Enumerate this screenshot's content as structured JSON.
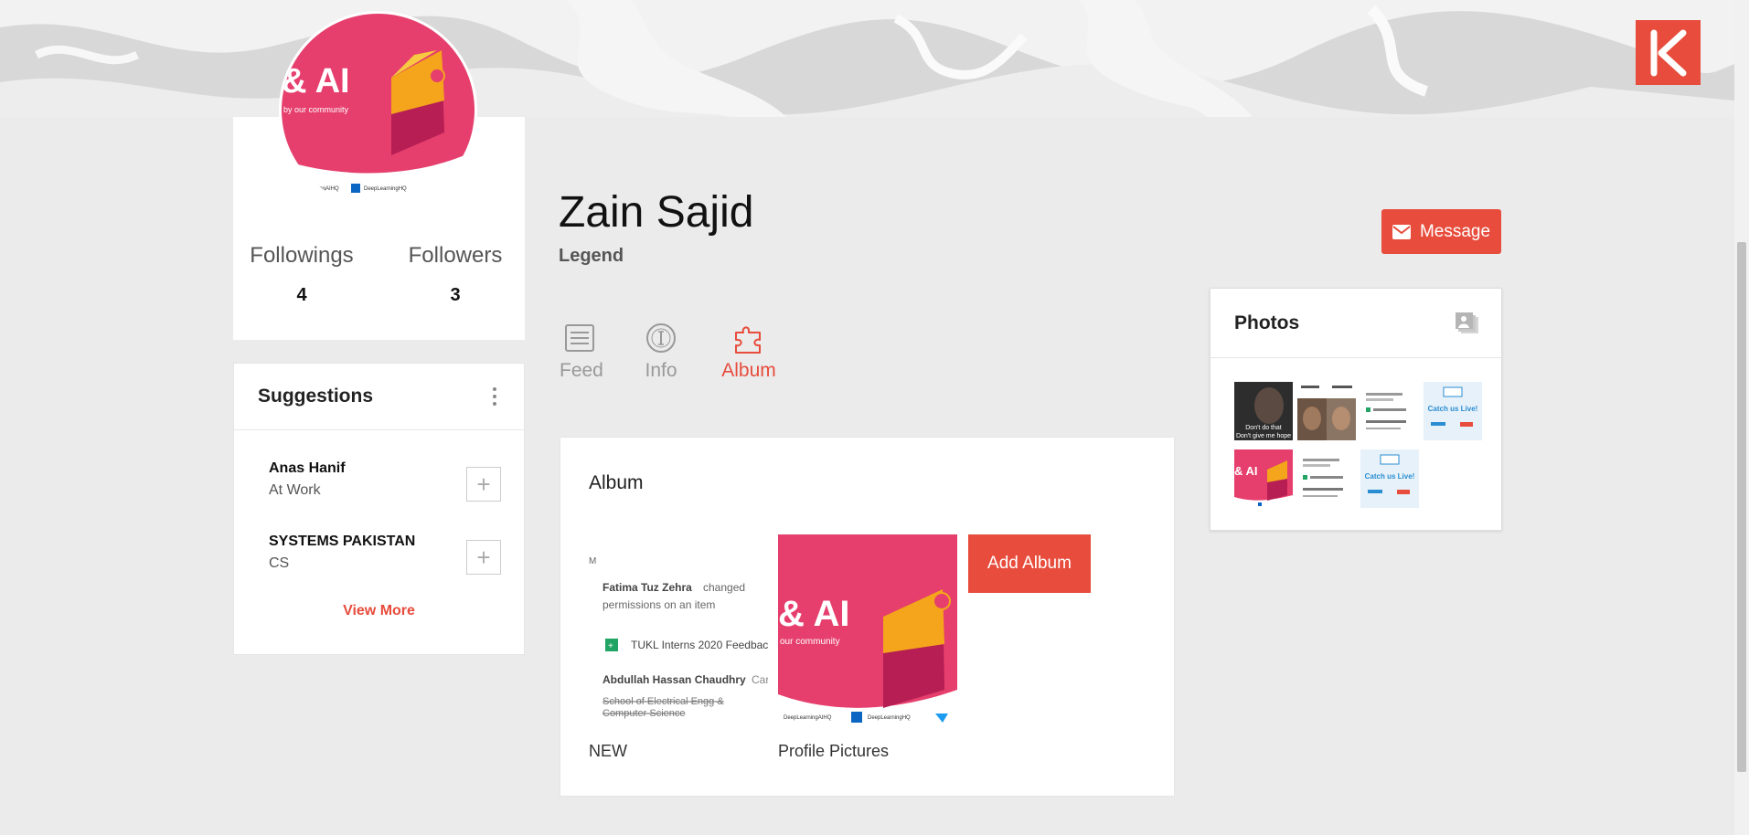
{
  "colors": {
    "accent": "#e74c3c",
    "page_bg": "#ebebeb"
  },
  "brand": {
    "logo_letter": "K"
  },
  "profile": {
    "name": "Zain Sajid",
    "role": "Legend",
    "avatar_text": "& AI",
    "avatar_sub": "by our community",
    "avatar_footer_left": "ingAIHQ",
    "avatar_footer_right": "DeepLearningHQ",
    "followings_label": "Followings",
    "followings_count": "4",
    "followers_label": "Followers",
    "followers_count": "3",
    "message_label": "Message"
  },
  "suggestions": {
    "title": "Suggestions",
    "items": [
      {
        "name": "Anas Hanif",
        "sub": "At Work"
      },
      {
        "name": "SYSTEMS PAKISTAN",
        "sub": "CS"
      }
    ],
    "view_more": "View More"
  },
  "tabs": [
    {
      "label": "Feed",
      "icon": "feed-icon"
    },
    {
      "label": "Info",
      "icon": "info-icon"
    },
    {
      "label": "Album",
      "icon": "puzzle-icon",
      "active": true
    }
  ],
  "album": {
    "title": "Album",
    "add_label": "Add Album",
    "items": [
      {
        "label": "NEW",
        "preview": {
          "line1_name": "Fatima Tuz Zehra",
          "line1_rest": "changed",
          "line2": "permissions on an item",
          "doc": "TUKL Interns 2020 Feedbac",
          "person": "Abdullah Hassan Chaudhry",
          "person_tail": "Car",
          "strike1": "School of Electrical Engg &",
          "strike2": "Computer Science"
        }
      },
      {
        "label": "Profile Pictures",
        "preview": {
          "text": "& AI",
          "sub": "our community",
          "footer1": "DeepLearningAIHQ",
          "footer2": "DeepLearningHQ"
        }
      }
    ]
  },
  "photos": {
    "title": "Photos",
    "thumb1_line1": "Don't do that",
    "thumb1_line2": "Don't give me hope",
    "thumb_catch": "Catch us Live!"
  }
}
